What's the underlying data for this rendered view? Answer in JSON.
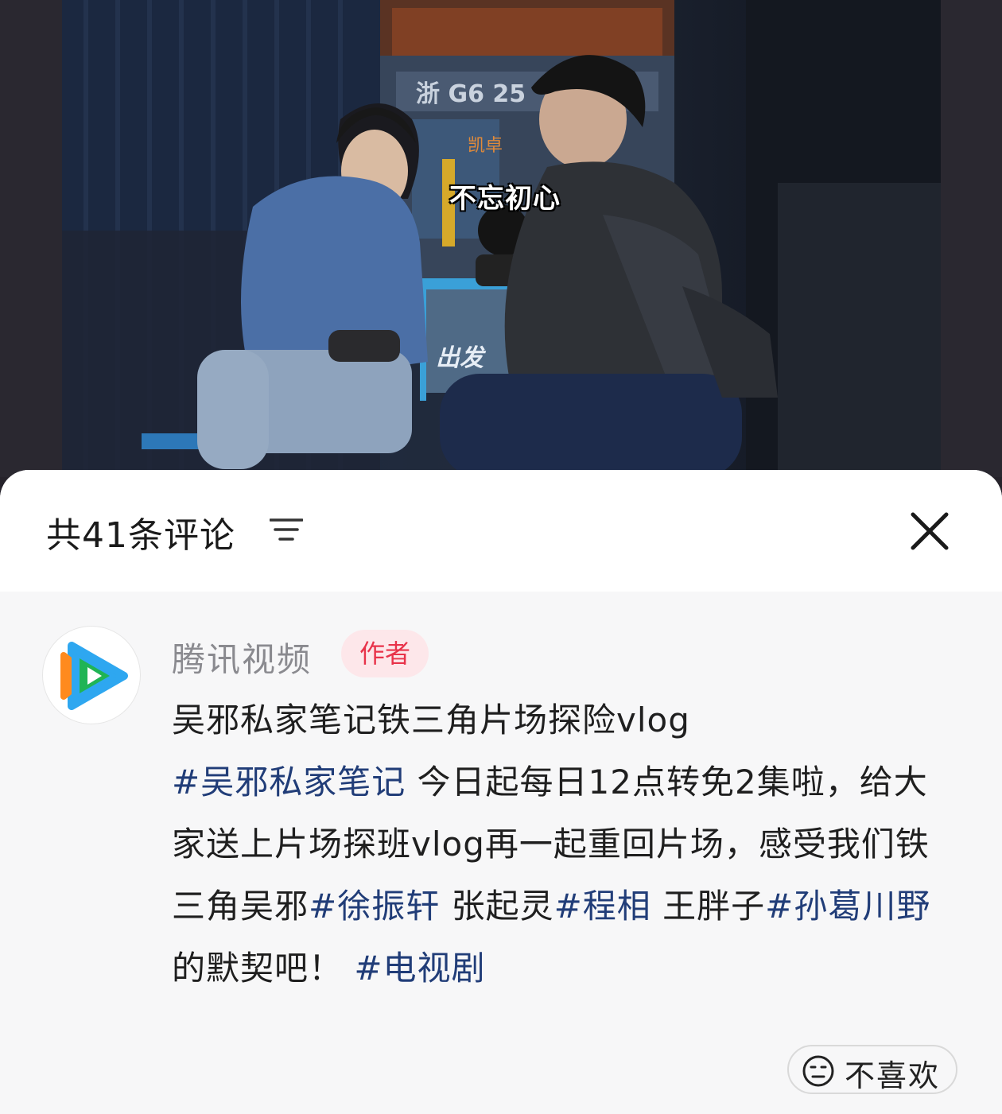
{
  "video": {
    "subtitle": "不忘初心",
    "plate_text": "浙 G6 25",
    "truck_text": "凯卓",
    "watermark": "出发"
  },
  "header": {
    "comment_count_label": "共41条评论",
    "sort_icon": "filter-lines-icon",
    "close_icon": "close-icon"
  },
  "post": {
    "author": "腾讯视频",
    "author_badge": "作者",
    "avatar_icon": "tencent-video-logo",
    "title": "吴邪私家笔记铁三角片场探险vlog",
    "body": [
      {
        "text": "#吴邪私家笔记",
        "tag": true
      },
      {
        "text": " 今日起每日12点转免2集啦，给大家送上片场探班vlog再一起重回片场，感受我们铁三角吴邪",
        "tag": false
      },
      {
        "text": "#徐振轩",
        "tag": true
      },
      {
        "text": " 张起灵",
        "tag": false
      },
      {
        "text": "#程相",
        "tag": true
      },
      {
        "text": " 王胖子",
        "tag": false
      },
      {
        "text": "#孙葛川野",
        "tag": true
      },
      {
        "text": " 的默契吧！ ",
        "tag": false
      },
      {
        "text": "#电视剧",
        "tag": true
      }
    ],
    "dislike_label": "不喜欢",
    "dislike_icon": "neutral-face-icon"
  },
  "colors": {
    "tag": "#213d78",
    "badge_text": "#e8334a",
    "badge_bg": "#fde7ea"
  }
}
